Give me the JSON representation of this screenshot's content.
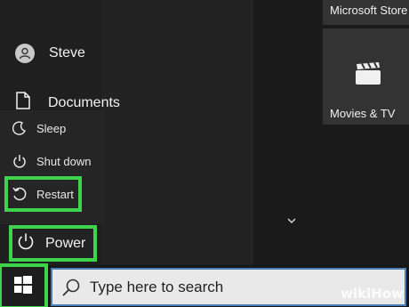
{
  "user": {
    "name": "Steve"
  },
  "nav": {
    "documents": "Documents"
  },
  "power_menu": {
    "sleep": "Sleep",
    "shutdown": "Shut down",
    "restart": "Restart"
  },
  "power_button": {
    "label": "Power"
  },
  "tiles": {
    "store": "Microsoft Store",
    "movies": "Movies & TV"
  },
  "taskbar": {
    "search_placeholder": "Type here to search"
  },
  "watermark": {
    "text": "wikiHow"
  },
  "colors": {
    "highlight": "#3dd34a",
    "search_border": "#4a7eb9"
  },
  "icons": {
    "user": "person-icon",
    "documents": "document-icon",
    "sleep": "moon-icon",
    "shutdown": "power-icon",
    "restart": "restart-icon",
    "power": "power-icon",
    "movies": "clapperboard-icon",
    "start": "windows-logo-icon",
    "search": "search-icon"
  }
}
